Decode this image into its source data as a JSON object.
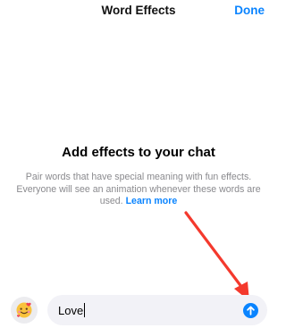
{
  "header": {
    "title": "Word Effects",
    "done_label": "Done"
  },
  "empty_state": {
    "heading": "Add effects to your chat",
    "description": "Pair words that have special meaning with fun effects. Everyone will see an animation whenever these words are used.",
    "link_label": "Learn more"
  },
  "composer": {
    "text": "Love",
    "sticker_icon": "sticker-emoji-icon",
    "send_icon": "arrow-up-icon"
  },
  "colors": {
    "accent": "#0a84ff",
    "annotation_arrow": "#f4392d"
  }
}
